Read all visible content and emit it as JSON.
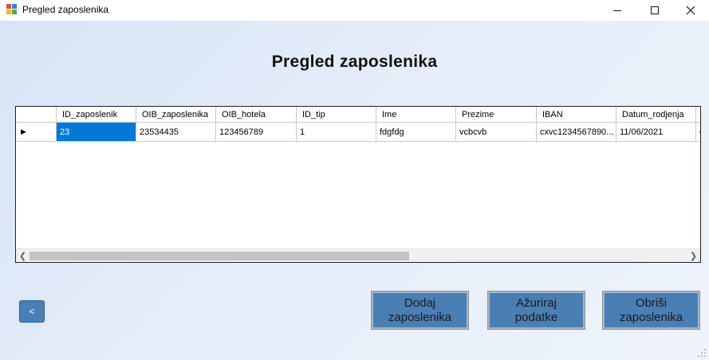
{
  "window": {
    "title": "Pregled zaposlenika"
  },
  "page": {
    "heading": "Pregled zaposlenika"
  },
  "grid": {
    "columns": [
      {
        "label": "ID_zaposlenik",
        "width": 100
      },
      {
        "label": "OIB_zaposlenika",
        "width": 100
      },
      {
        "label": "OIB_hotela",
        "width": 101
      },
      {
        "label": "ID_tip",
        "width": 100
      },
      {
        "label": "Ime",
        "width": 100
      },
      {
        "label": "Prezime",
        "width": 101
      },
      {
        "label": "IBAN",
        "width": 100
      },
      {
        "label": "Datum_rodjenja",
        "width": 100
      },
      {
        "label": "",
        "width": 20
      }
    ],
    "rows": [
      [
        "23",
        "23534435",
        "123456789",
        "1",
        "fdgfdg",
        "vcbcvb",
        "cxvc1234567890...",
        "11/06/2021",
        "c"
      ]
    ],
    "selected_cell": "0.0"
  },
  "buttons": {
    "back": "<",
    "add": "Dodaj\nzaposlenika",
    "update": "Ažuriraj\npodatke",
    "delete": "Obriši\nzaposlenika"
  },
  "colors": {
    "selection": "#0078d7",
    "button": "#4a7fb5"
  }
}
